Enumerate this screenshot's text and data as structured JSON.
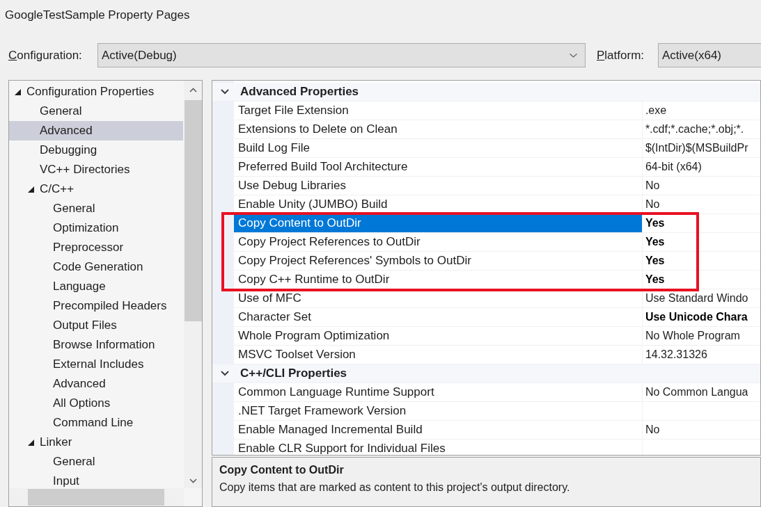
{
  "window": {
    "title": "GoogleTestSample Property Pages"
  },
  "configuration": {
    "label": "Configuration:",
    "value": "Active(Debug)"
  },
  "platform": {
    "label": "Platform:",
    "value": "Active(x64)"
  },
  "tree": [
    {
      "label": "Configuration Properties",
      "expanded": true,
      "selected": false,
      "children": [
        {
          "label": "General",
          "selected": false
        },
        {
          "label": "Advanced",
          "selected": true
        },
        {
          "label": "Debugging",
          "selected": false
        },
        {
          "label": "VC++ Directories",
          "selected": false
        },
        {
          "label": "C/C++",
          "expanded": true,
          "selected": false,
          "children": [
            {
              "label": "General",
              "selected": false
            },
            {
              "label": "Optimization",
              "selected": false
            },
            {
              "label": "Preprocessor",
              "selected": false
            },
            {
              "label": "Code Generation",
              "selected": false
            },
            {
              "label": "Language",
              "selected": false
            },
            {
              "label": "Precompiled Headers",
              "selected": false
            },
            {
              "label": "Output Files",
              "selected": false
            },
            {
              "label": "Browse Information",
              "selected": false
            },
            {
              "label": "External Includes",
              "selected": false
            },
            {
              "label": "Advanced",
              "selected": false
            },
            {
              "label": "All Options",
              "selected": false
            },
            {
              "label": "Command Line",
              "selected": false
            }
          ]
        },
        {
          "label": "Linker",
          "expanded": true,
          "selected": false,
          "children": [
            {
              "label": "General",
              "selected": false
            },
            {
              "label": "Input",
              "selected": false
            }
          ]
        }
      ]
    }
  ],
  "sections": [
    {
      "title": "Advanced Properties",
      "expanded": true,
      "rows": [
        {
          "name": "Target File Extension",
          "value": ".exe",
          "modified": false,
          "selected": false
        },
        {
          "name": "Extensions to Delete on Clean",
          "value": "*.cdf;*.cache;*.obj;*.",
          "modified": false,
          "selected": false
        },
        {
          "name": "Build Log File",
          "value": "$(IntDir)$(MSBuildPr",
          "modified": false,
          "selected": false
        },
        {
          "name": "Preferred Build Tool Architecture",
          "value": "64-bit (x64)",
          "modified": false,
          "selected": false
        },
        {
          "name": "Use Debug Libraries",
          "value": "No",
          "modified": false,
          "selected": false
        },
        {
          "name": "Enable Unity (JUMBO) Build",
          "value": "No",
          "modified": false,
          "selected": false
        },
        {
          "name": "Copy Content to OutDir",
          "value": "Yes",
          "modified": true,
          "selected": true
        },
        {
          "name": "Copy Project References to OutDir",
          "value": "Yes",
          "modified": true,
          "selected": false
        },
        {
          "name": "Copy Project References' Symbols to OutDir",
          "value": "Yes",
          "modified": true,
          "selected": false
        },
        {
          "name": "Copy C++ Runtime to OutDir",
          "value": "Yes",
          "modified": true,
          "selected": false
        },
        {
          "name": "Use of MFC",
          "value": "Use Standard Windo",
          "modified": false,
          "selected": false
        },
        {
          "name": "Character Set",
          "value": "Use Unicode Chara",
          "modified": true,
          "selected": false
        },
        {
          "name": "Whole Program Optimization",
          "value": "No Whole Program",
          "modified": false,
          "selected": false
        },
        {
          "name": "MSVC Toolset Version",
          "value": "14.32.31326",
          "modified": false,
          "selected": false
        }
      ]
    },
    {
      "title": "C++/CLI Properties",
      "expanded": true,
      "rows": [
        {
          "name": "Common Language Runtime Support",
          "value": "No Common Langua",
          "modified": false,
          "selected": false
        },
        {
          "name": ".NET Target Framework Version",
          "selected": false
        },
        {
          "name": "Enable Managed Incremental Build",
          "value": "No",
          "modified": false,
          "selected": false
        },
        {
          "name": "Enable CLR Support for Individual Files",
          "selected": false
        }
      ]
    }
  ],
  "annotation": {
    "kind": "rectangle"
  },
  "description": {
    "title": "Copy Content to OutDir",
    "text": "Copy items that are marked as content to this project's output directory."
  }
}
